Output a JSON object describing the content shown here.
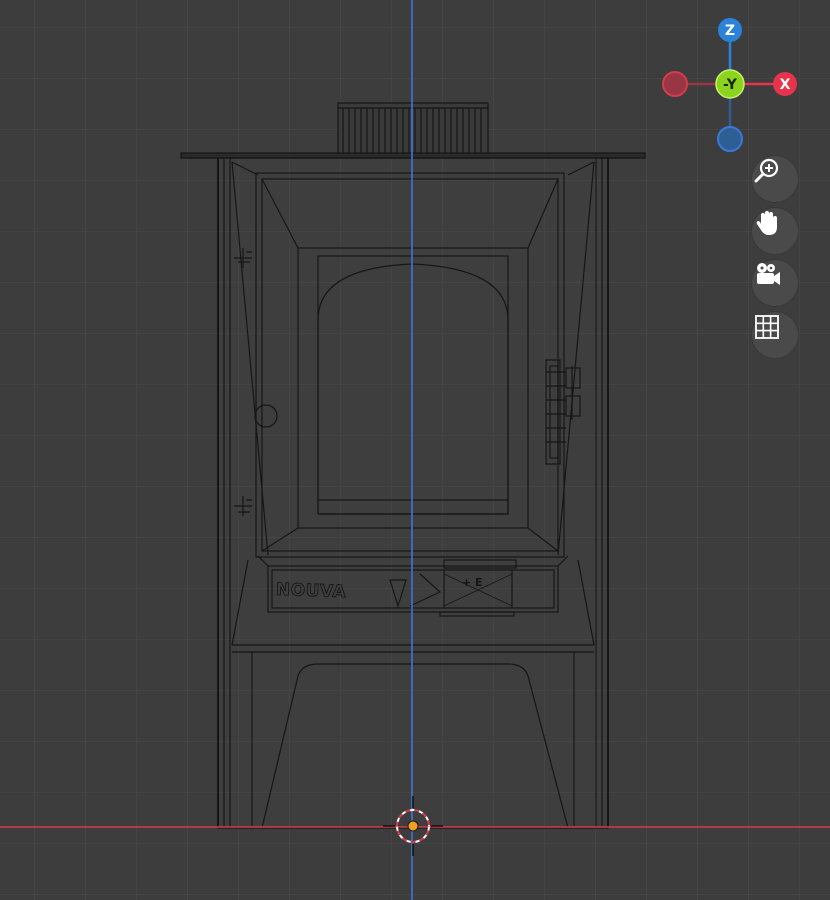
{
  "viewport": {
    "background": "#3d3d3d",
    "grid_color": "#4a4a4a",
    "axis_x_color": "#d63a4d",
    "axis_z_color": "#3b78d8"
  },
  "model": {
    "brand_text": "NOUVA",
    "panel_text": "+ E",
    "wire_color": "#161616"
  },
  "gizmo": {
    "z_label": "Z",
    "y_label": "-Y",
    "x_label": "X",
    "z_color": "#2b83d9",
    "y_color": "#8cd31e",
    "x_color": "#e8334c",
    "neg_x_color": "#9a3644",
    "neg_z_color": "#2d5f94"
  },
  "tools": [
    {
      "name": "zoom-icon"
    },
    {
      "name": "hand-icon"
    },
    {
      "name": "camera-icon"
    },
    {
      "name": "grid-icon"
    }
  ]
}
